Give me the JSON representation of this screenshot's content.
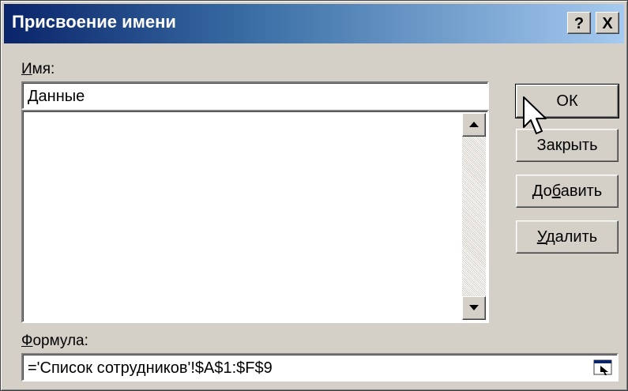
{
  "window": {
    "title": "Присвоение имени",
    "help_label": "?",
    "close_label": "X"
  },
  "name_section": {
    "label_accel": "И",
    "label_rest": "мя:",
    "value": "Данные"
  },
  "names_list": {
    "items": []
  },
  "formula_section": {
    "label_accel": "Ф",
    "label_rest": "ормула:",
    "value": "='Список сотрудников'!$A$1:$F$9"
  },
  "buttons": {
    "ok": "ОК",
    "close": "Закрыть",
    "add_pre": "До",
    "add_accel": "б",
    "add_post": "авить",
    "delete_accel": "У",
    "delete_rest": "далить"
  },
  "icons": {
    "scroll_up": "arrow-up-icon",
    "scroll_down": "arrow-down-icon",
    "collapse_dialog": "collapse-dialog-icon",
    "mouse_pointer": "mouse-pointer-icon"
  }
}
